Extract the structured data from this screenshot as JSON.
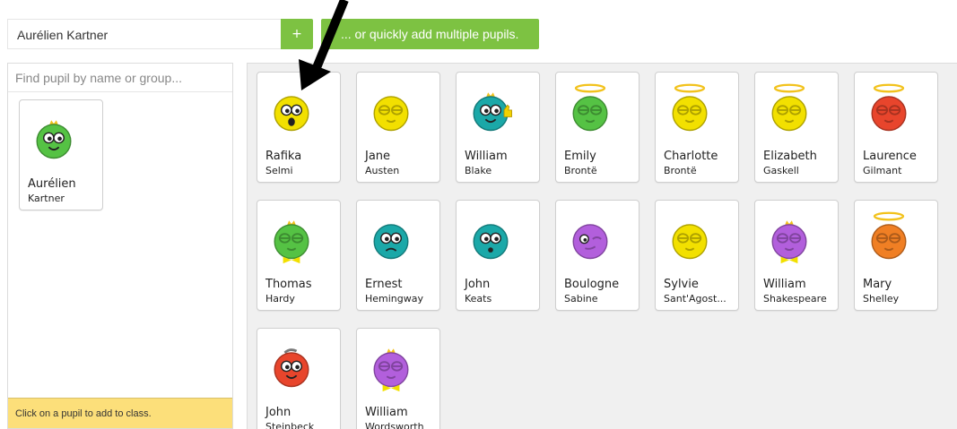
{
  "add_bar": {
    "name_value": "Aurélien Kartner",
    "add_label": "+",
    "multi_label": "... or quickly add multiple pupils."
  },
  "left_panel": {
    "search_placeholder": "Find pupil by name or group...",
    "pupils": [
      {
        "first": "Aurélien",
        "last": "Kartner",
        "color": "#55c244",
        "icon": "smiley-crown-icon"
      }
    ],
    "hint": "Click on a pupil to add to class."
  },
  "right_panel": {
    "pupils": [
      {
        "first": "Rafika",
        "last": "Selmi",
        "color": "#f2e000",
        "icon": "shocked-face-icon"
      },
      {
        "first": "Jane",
        "last": "Austen",
        "color": "#f2e000",
        "icon": "sleepy-face-icon"
      },
      {
        "first": "William",
        "last": "Blake",
        "color": "#1ba8a8",
        "icon": "thumbs-up-face-icon"
      },
      {
        "first": "Emily",
        "last": "Brontë",
        "color": "#55c244",
        "icon": "halo-face-icon"
      },
      {
        "first": "Charlotte",
        "last": "Brontë",
        "color": "#f2e000",
        "icon": "halo-face-icon"
      },
      {
        "first": "Elizabeth",
        "last": "Gaskell",
        "color": "#f2e000",
        "icon": "halo-face-icon"
      },
      {
        "first": "Laurence",
        "last": "Gilmant",
        "color": "#e8452c",
        "icon": "halo-face-icon"
      },
      {
        "first": "Thomas",
        "last": "Hardy",
        "color": "#55c244",
        "icon": "bowtie-face-icon"
      },
      {
        "first": "Ernest",
        "last": "Hemingway",
        "color": "#1ba8a8",
        "icon": "sad-face-icon"
      },
      {
        "first": "John",
        "last": "Keats",
        "color": "#1ba8a8",
        "icon": "surprised-face-icon"
      },
      {
        "first": "Boulogne",
        "last": "Sabine",
        "color": "#b25fdc",
        "icon": "winking-face-icon"
      },
      {
        "first": "Sylvie",
        "last": "Sant'Agost...",
        "color": "#f2e000",
        "icon": "sleepy-face-icon"
      },
      {
        "first": "William",
        "last": "Shakespeare",
        "color": "#b25fdc",
        "icon": "bowtie-face-icon"
      },
      {
        "first": "Mary",
        "last": "Shelley",
        "color": "#f07f24",
        "icon": "halo-face-icon"
      },
      {
        "first": "John",
        "last": "Steinbeck",
        "color": "#e8452c",
        "icon": "smiley-face-icon"
      },
      {
        "first": "William",
        "last": "Wordsworth",
        "color": "#b25fdc",
        "icon": "bowtie-face-icon"
      }
    ]
  }
}
